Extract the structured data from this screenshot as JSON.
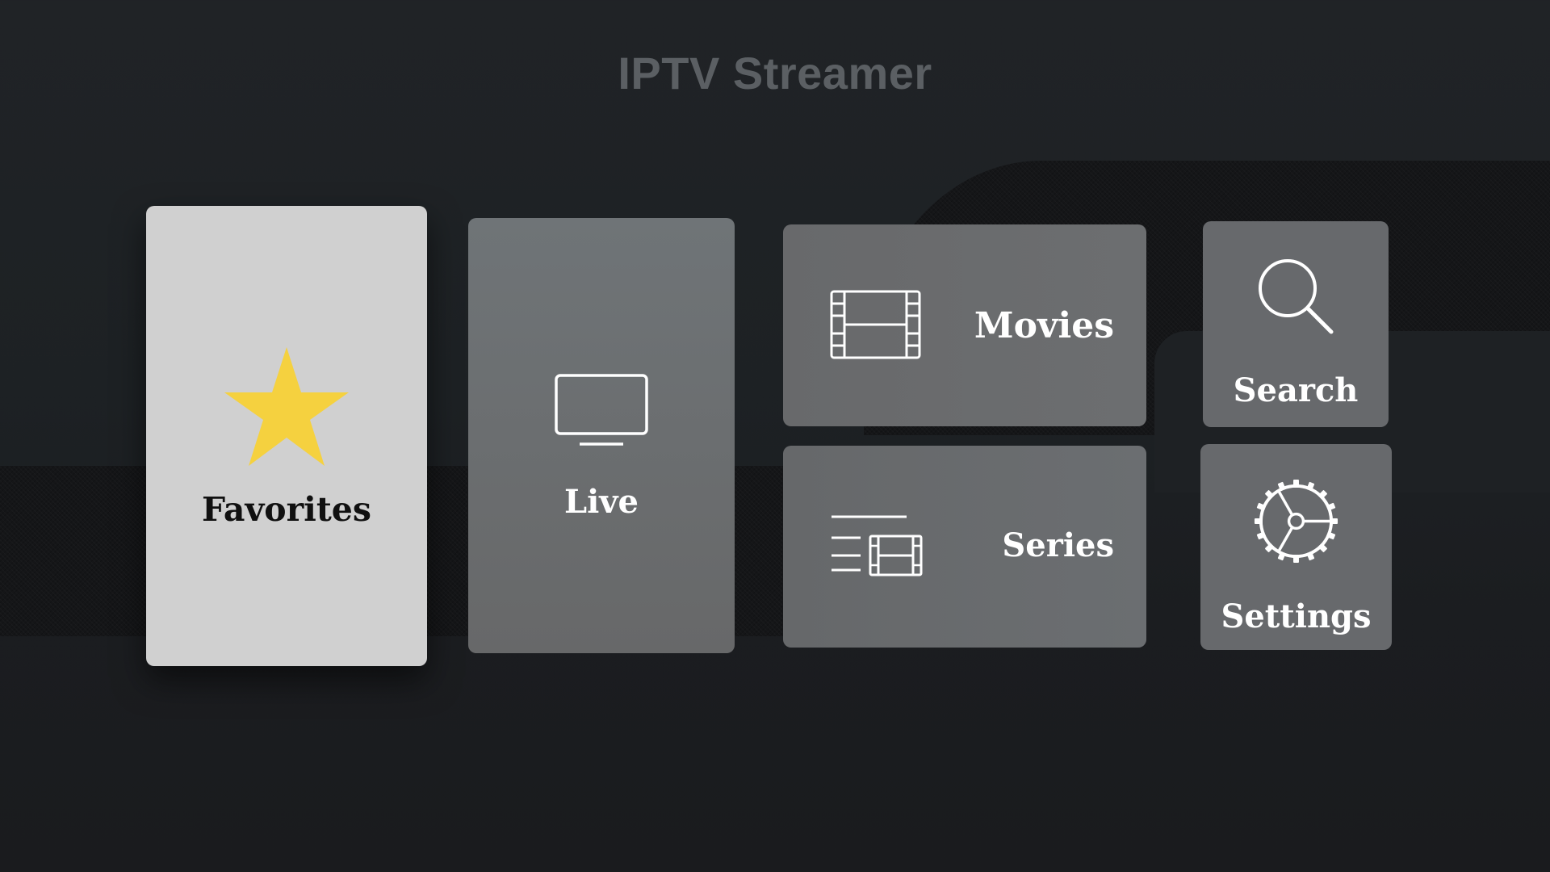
{
  "app": {
    "title": "IPTV Streamer"
  },
  "menu": {
    "focused": "favorites",
    "tiles": [
      {
        "id": "favorites",
        "label": "Favorites",
        "icon": "star-icon",
        "icon_color": "#F5D13F"
      },
      {
        "id": "live",
        "label": "Live",
        "icon": "tv-icon"
      },
      {
        "id": "movies",
        "label": "Movies",
        "icon": "film-icon"
      },
      {
        "id": "series",
        "label": "Series",
        "icon": "series-list-icon"
      },
      {
        "id": "search",
        "label": "Search",
        "icon": "search-icon"
      },
      {
        "id": "settings",
        "label": "Settings",
        "icon": "gear-icon"
      }
    ]
  },
  "colors": {
    "focused_tile": "#D0D0D0",
    "tile": "#67696C",
    "title": "#5B5F63",
    "background": "#1E2124",
    "star": "#F5D13F"
  }
}
